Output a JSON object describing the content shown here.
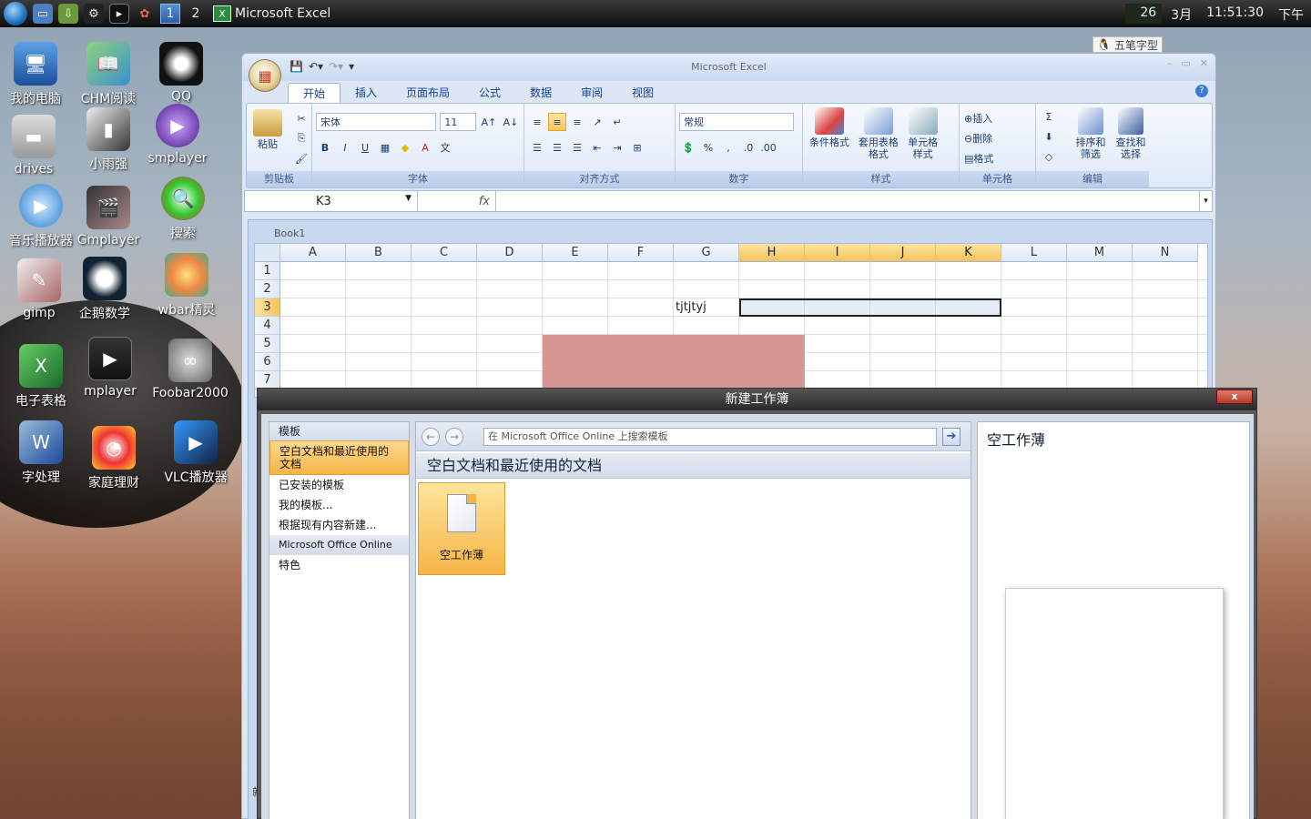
{
  "taskbar": {
    "workspaces": [
      "1",
      "2"
    ],
    "task_label": "Microsoft Excel",
    "clock": {
      "day": "26",
      "month": "3月",
      "time": "11:51:30",
      "ampm": "下午"
    }
  },
  "ime": {
    "label": "五笔字型"
  },
  "desktop": {
    "icons": [
      {
        "label": "我的电脑"
      },
      {
        "label": "CHM阅读"
      },
      {
        "label": "QQ"
      },
      {
        "label": "drives"
      },
      {
        "label": "小雨强"
      },
      {
        "label": "smplayer"
      },
      {
        "label": "音乐播放器"
      },
      {
        "label": "Gmplayer"
      },
      {
        "label": "搜索"
      },
      {
        "label": "gimp"
      },
      {
        "label": "企鹅数学"
      },
      {
        "label": "wbar精灵"
      },
      {
        "label": "电子表格"
      },
      {
        "label": "mplayer"
      },
      {
        "label": "Foobar2000"
      },
      {
        "label": "字处理"
      },
      {
        "label": "家庭理财"
      },
      {
        "label": "VLC播放器"
      }
    ]
  },
  "excel": {
    "title": "Microsoft Excel",
    "tabs": [
      "开始",
      "插入",
      "页面布局",
      "公式",
      "数据",
      "审阅",
      "视图"
    ],
    "active_tab": "开始",
    "groups": {
      "clipboard": "剪贴板",
      "font": "字体",
      "alignment": "对齐方式",
      "number": "数字",
      "styles": "样式",
      "cells": "单元格",
      "editing": "编辑"
    },
    "paste_label": "粘贴",
    "font_name": "宋体",
    "font_size": "11",
    "number_format": "常规",
    "styles_buttons": [
      "条件格式",
      "套用表格格式",
      "单元格样式"
    ],
    "cells_buttons": [
      "插入",
      "删除",
      "格式"
    ],
    "editing_buttons": [
      "排序和筛选",
      "查找和选择"
    ],
    "name_box": "K3",
    "fx": "fx",
    "workbook_title": "Book1",
    "columns": [
      "A",
      "B",
      "C",
      "D",
      "E",
      "F",
      "G",
      "H",
      "I",
      "J",
      "K",
      "L",
      "M",
      "N"
    ],
    "rows": [
      "1",
      "2",
      "3",
      "4",
      "5",
      "6",
      "7"
    ],
    "cell_G3": "tjtjtyj",
    "status_char": "就"
  },
  "dialog": {
    "title": "新建工作簿",
    "close": "x",
    "left_header": "模板",
    "left_items": [
      "空白文档和最近使用的文档",
      "已安装的模板",
      "我的模板...",
      "根据现有内容新建..."
    ],
    "online_section": "Microsoft Office Online",
    "featured": "特色",
    "search_placeholder": "在 Microsoft Office Online 上搜索模板",
    "mid_header": "空白文档和最近使用的文档",
    "tile_label": "空工作薄",
    "right_title": "空工作薄"
  }
}
